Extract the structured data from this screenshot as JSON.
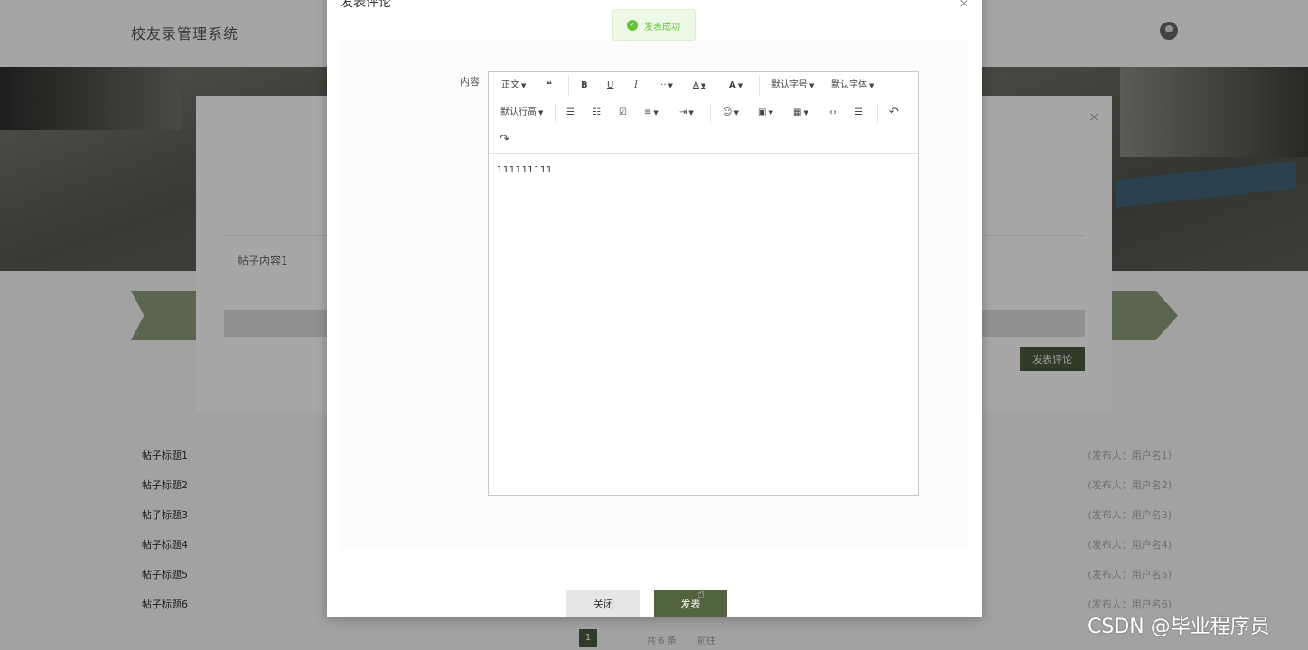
{
  "app": {
    "title": "校友录管理系统"
  },
  "background": {
    "post_content": "帖子内容1",
    "comment_button": "发表评论",
    "list": [
      {
        "title": "帖子标题1",
        "publisher": "(发布人：用户名1)"
      },
      {
        "title": "帖子标题2",
        "publisher": "(发布人：用户名2)"
      },
      {
        "title": "帖子标题3",
        "publisher": "(发布人：用户名3)"
      },
      {
        "title": "帖子标题4",
        "publisher": "(发布人：用户名4)"
      },
      {
        "title": "帖子标题5",
        "publisher": "(发布人：用户名5)"
      },
      {
        "title": "帖子标题6",
        "publisher": "(发布人：用户名6)"
      }
    ],
    "pagination": {
      "current": "1",
      "total": "共 6 条",
      "goto": "前往"
    }
  },
  "modal": {
    "title": "发表评论",
    "close_icon": "×",
    "field_label": "内容",
    "toolbar": {
      "paragraph": "正文",
      "quote": "❝",
      "bold": "B",
      "underline": "U",
      "italic": "I",
      "more": "···",
      "font_color": "A",
      "bg_color": "A",
      "font_size": "默认字号",
      "font_family": "默认字体",
      "line_height": "默认行高",
      "bullet_list": "☰",
      "numbered_list": "☷",
      "todo": "☑",
      "align": "≡",
      "indent": "⇥",
      "emoji": "☺",
      "image": "▣",
      "table": "▦",
      "code": "‹›",
      "divider": "☰",
      "undo": "↶",
      "redo": "↷"
    },
    "content_value": "111111111",
    "buttons": {
      "close": "关闭",
      "publish": "发表"
    }
  },
  "toast": {
    "message": "发表成功"
  },
  "watermark": "CSDN @毕业程序员",
  "colors": {
    "accent": "#52643f",
    "success": "#67c23a"
  }
}
